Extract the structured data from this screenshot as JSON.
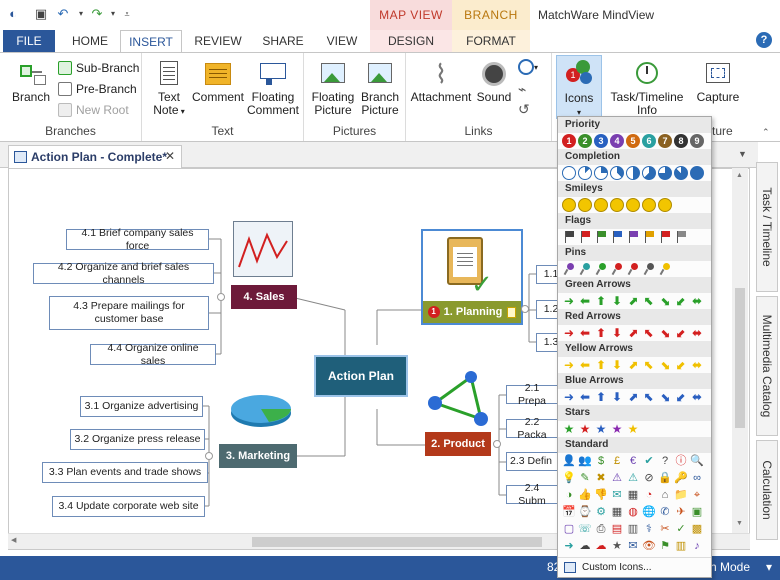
{
  "title_bar": {
    "app_title": "MatchWare MindView",
    "context_tabs": [
      "MAP VIEW",
      "BRANCH"
    ],
    "context_colors": [
      "#f8dcdc",
      "#fbeccd"
    ]
  },
  "tabs": [
    "FILE",
    "HOME",
    "INSERT",
    "REVIEW",
    "SHARE",
    "VIEW",
    "DESIGN",
    "FORMAT"
  ],
  "active_tab": "INSERT",
  "ribbon": {
    "groups": {
      "branches": "Branches",
      "text": "Text",
      "pictures": "Pictures",
      "links": "Links",
      "capture": "ture"
    },
    "buttons": {
      "branch": "Branch",
      "sub_branch": "Sub-Branch",
      "pre_branch": "Pre-Branch",
      "new_root": "New Root",
      "text_note_1": "Text",
      "text_note_2": "Note",
      "comment": "Comment",
      "floating_comment_1": "Floating",
      "floating_comment_2": "Comment",
      "floating_picture_1": "Floating",
      "floating_picture_2": "Picture",
      "branch_picture_1": "Branch",
      "branch_picture_2": "Picture",
      "attachment": "Attachment",
      "sound": "Sound",
      "icons": "Icons",
      "task_timeline_1": "Task/Timeline",
      "task_timeline_2": "Info",
      "capture": "Capture"
    }
  },
  "document_tab": "Action Plan - Complete*",
  "map": {
    "root": "Action Plan",
    "branches": {
      "planning": {
        "label": "1. Planning",
        "color": "#8a9a2e",
        "children": [
          "1.1",
          "1.2",
          "1.3"
        ]
      },
      "product": {
        "label": "2. Product",
        "color": "#b3391a",
        "children": [
          "2.1  Prepa",
          "2.2  Packa",
          "2.3  Defin",
          "2.4  Subm"
        ]
      },
      "marketing": {
        "label": "3. Marketing",
        "color": "#4d6a70",
        "children": [
          "3.1  Organize advertising",
          "3.2  Organize press release",
          "3.3 Plan events and trade shows",
          "3.4  Update corporate web site"
        ]
      },
      "sales": {
        "label": "4. Sales",
        "color": "#6d1a3a",
        "children": [
          "4.1  Brief company sales force",
          "4.2  Organize and brief sales channels",
          "4.3 Prepare mailings for customer base",
          "4.4  Organize online sales"
        ]
      }
    },
    "root_color": "#1f5f7a"
  },
  "side_tabs": [
    "Task / Timeline",
    "Multimedia Catalog",
    "Calculation"
  ],
  "status": {
    "zoom": "82",
    "mode": "h Mode"
  },
  "icons_menu": {
    "sections": [
      "Priority",
      "Completion",
      "Smileys",
      "Flags",
      "Pins",
      "Green Arrows",
      "Red Arrows",
      "Yellow Arrows",
      "Blue Arrows",
      "Stars",
      "Standard"
    ],
    "priority_numbers": [
      "1",
      "2",
      "3",
      "4",
      "5",
      "6",
      "7",
      "8",
      "9"
    ],
    "priority_colors": [
      "#d22020",
      "#3a8f2a",
      "#2860c0",
      "#7a3fb0",
      "#d06a10",
      "#2aa0a0",
      "#8a6020",
      "#333333",
      "#666666"
    ],
    "flag_colors": [
      "#444444",
      "#d22020",
      "#3a8f2a",
      "#2860c0",
      "#7a3fb0",
      "#e0a000",
      "#d22020",
      "#888888"
    ],
    "arrow_colors": {
      "green": "#2aa02a",
      "red": "#d42020",
      "yellow": "#f0c000",
      "blue": "#2a5fc0"
    },
    "star_colors": [
      "#2aa02a",
      "#d42020",
      "#2a5fc0",
      "#8a2ab0",
      "#f0c000"
    ],
    "custom_label": "Custom Icons..."
  }
}
